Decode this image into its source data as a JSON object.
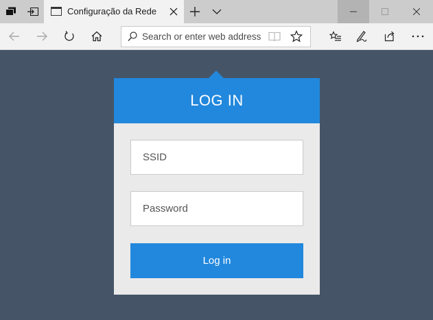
{
  "browser": {
    "tab": {
      "title": "Configuração da Rede"
    },
    "address_bar": {
      "placeholder": "Search or enter web address"
    },
    "icons": {
      "tab_manager": "tab-manager-icon",
      "set_aside": "set-aside-tabs-icon",
      "page": "page-icon",
      "close_tab": "close-icon",
      "new_tab": "plus-icon",
      "tab_list": "chevron-down-icon",
      "back": "back-arrow-icon",
      "forward": "forward-arrow-icon",
      "refresh": "refresh-icon",
      "home": "home-icon",
      "search": "search-icon",
      "reading_view": "book-icon",
      "favorite": "star-icon",
      "favorites_hub": "favorites-list-icon",
      "notes": "pen-icon",
      "share": "share-icon",
      "more": "ellipsis-icon"
    }
  },
  "login": {
    "title": "LOG IN",
    "ssid_placeholder": "SSID",
    "password_placeholder": "Password",
    "submit_label": "Log in"
  },
  "colors": {
    "page_background": "#455567",
    "accent": "#2288dd",
    "card_background": "#eaeaea",
    "titlebar": "#cccccc",
    "toolbar": "#f2f2f2"
  }
}
